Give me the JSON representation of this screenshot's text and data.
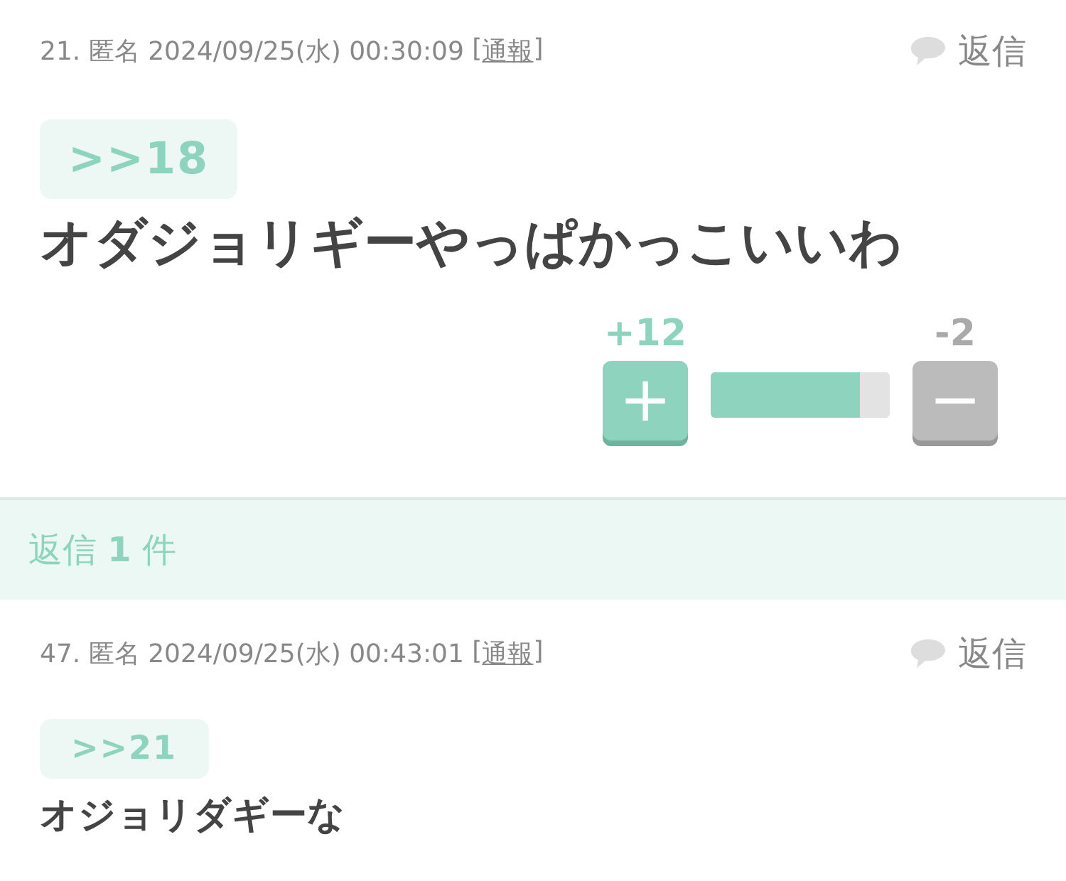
{
  "posts": [
    {
      "meta": "21. 匿名 2024/09/25(水) 00:30:09",
      "report": {
        "open": "[",
        "label": "通報",
        "close": "]"
      },
      "reply_button": "返信",
      "anchor": ">>18",
      "body": "オダジョリギーやっぱかっこいいわ",
      "kind": "large",
      "votes": {
        "plus_count": "+12",
        "plus_symbol": "+",
        "minus_count": "-2",
        "minus_symbol": "−",
        "level": 0.83
      }
    },
    {
      "meta": "47. 匿名 2024/09/25(水) 00:43:01",
      "report": {
        "open": "[",
        "label": "通報",
        "close": "]"
      },
      "reply_button": "返信",
      "anchor": ">>21",
      "body": "オジョリダギーな",
      "kind": "small"
    }
  ],
  "reply_count": "返信 **1** 件"
}
